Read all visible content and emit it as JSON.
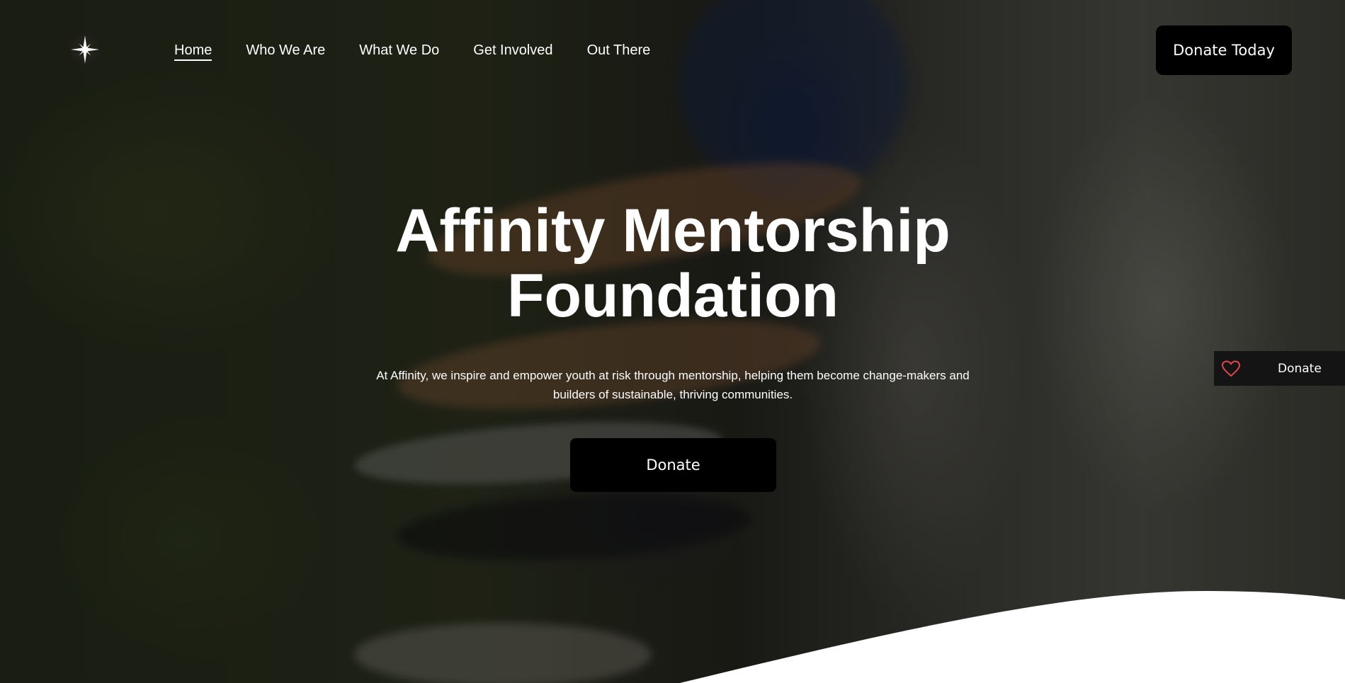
{
  "nav": {
    "logo_icon": "compass-star-icon",
    "items": [
      {
        "label": "Home",
        "active": true
      },
      {
        "label": "Who We Are"
      },
      {
        "label": "What We Do"
      },
      {
        "label": "Get Involved"
      },
      {
        "label": "Out There"
      }
    ],
    "donate_today": "Donate Today"
  },
  "hero": {
    "title_line1": "Affinity Mentorship",
    "title_line2": "Foundation",
    "subtitle_line1": "At Affinity, we inspire and empower youth at risk through mentorship, helping them become change-makers and",
    "subtitle_line2": "builders  of sustainable, thriving communities.",
    "donate_button": "Donate"
  },
  "side_widget": {
    "icon": "heart-icon",
    "label": "Donate",
    "heart_color": "#e0474c"
  },
  "colors": {
    "button_bg": "#000000",
    "text": "#ffffff"
  }
}
